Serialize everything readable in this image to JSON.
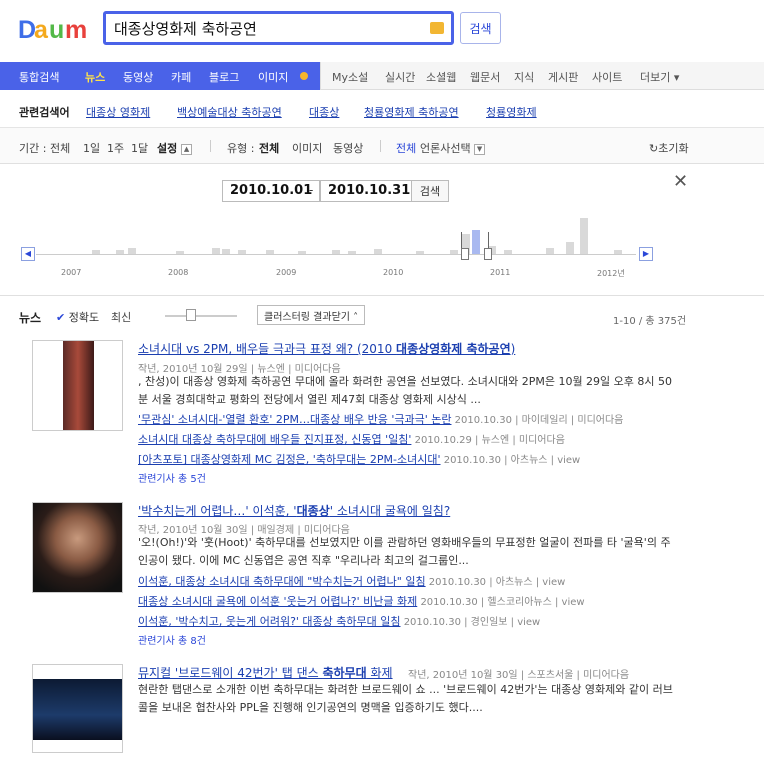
{
  "header": {
    "search_value": "대종상영화제 축하공연",
    "search_button": "검색",
    "colors": {
      "accent": "#4a62e8",
      "link": "#1b3fb0"
    }
  },
  "tabs": [
    "통합검색",
    "뉴스",
    "동영상",
    "카페",
    "블로그",
    "이미지",
    "My소설",
    "실시간",
    "소셜웹",
    "웹문서",
    "지식",
    "게시판",
    "사이트",
    "더보기"
  ],
  "related": {
    "label": "관련검색어",
    "items": [
      "대종상 영화제",
      "백상예술대상 축하공연",
      "대종상",
      "청룡영화제 축하공연",
      "청룡영화제"
    ]
  },
  "filters": {
    "period_label": "기간 :",
    "period_options": [
      "전체",
      "1일",
      "1주",
      "1달",
      "설정"
    ],
    "type_label": "유형 :",
    "type_options": [
      "전체",
      "이미지",
      "동영상"
    ],
    "press_all": "전체",
    "press_select": "언론사선택",
    "reset": "초기화"
  },
  "timeline": {
    "start": "2010.10.01",
    "end": "2010.10.31",
    "button": "검색",
    "years": [
      "2007",
      "2008",
      "2009",
      "2010",
      "2011",
      "2012년"
    ]
  },
  "results_header": {
    "title": "뉴스",
    "accuracy": "정확도",
    "recent": "최신",
    "cluster": "클러스터링 결과닫기",
    "count": "1-10 / 총 375건"
  },
  "results": [
    {
      "title_a": "소녀시대 vs 2PM, 배우들 극과극 표정 왜? (2010 ",
      "title_b": "대종상영화제 축하공연",
      "title_c": ")",
      "meta": "작년, 2010년 10월 29일 | 뉴스엔 | 미디어다음",
      "snippet": ", 찬성)이 대종상 영화제 축하공연 무대에 올라 화려한 공연을 선보였다. 소녀시대와 2PM은 10월 29일 오후 8시 50분 서울 경희대학교 평화의 전당에서 열린 제47회 대종상 영화제 시상식 ...",
      "subs": [
        {
          "text": "'무관심' 소녀시대-'열렬 환호' 2PM…대종상 배우 반응 '극과극' 논란",
          "meta": "2010.10.30 | 마이데일리 | 미디어다음"
        },
        {
          "text": "소녀시대 대종상 축하무대에 배우들 진지표정, 신동엽 '일침'",
          "meta": "2010.10.29 | 뉴스엔 | 미디어다음"
        },
        {
          "text": "[아츠포토] 대종상영화제 MC 김정은, '축하무대는 2PM-소녀시대'",
          "meta": "2010.10.30 | 아츠뉴스 | view"
        }
      ],
      "more": "관련기사 총 5건"
    },
    {
      "title_a": "'박수치는게 어렵나…' 이석훈, '",
      "title_b": "대종상",
      "title_c": "' 소녀시대 굴욕에 일침?",
      "meta": "작년, 2010년 10월 30일 | 매일경제 | 미디어다음",
      "snippet": "'오!(Oh!)'와 '훗(Hoot)' 축하무대를 선보였지만 이를 관람하던 영화배우들의 무표정한 얼굴이 전파를 타 '굴욕'의 주인공이 됐다. 이에 MC 신동엽은 공연 직후 \"우리나라 최고의 걸그룹인...",
      "subs": [
        {
          "text": "이석훈, 대종상 소녀시대 축하무대에 \"박수치는거 어렵나\" 일침",
          "meta": "2010.10.30 | 아츠뉴스 | view"
        },
        {
          "text": "대종상 소녀시대 굴욕에 이석훈 '웃는거 어렵나?' 비난글 화제",
          "meta": "2010.10.30 | 헬스코리아뉴스 | view"
        },
        {
          "text": "이석훈, '박수치고, 웃는게 어려워?' 대종상 축하무대 일침",
          "meta": "2010.10.30 | 경인일보 | view"
        }
      ],
      "more": "관련기사 총 8건"
    },
    {
      "title_a": "뮤지컬 '브로드웨이 42번가' 탭 댄스 ",
      "title_b": "축하무대",
      "title_c": " 화제",
      "meta": "작년, 2010년 10월 30일 | 스포츠서울 | 미디어다음",
      "snippet": "현란한 탭댄스로 소개한 이번 축하무대는 화려한 브로드웨이 쇼 ... '브로드웨이 42번가'는 대종상 영화제와 같이 러브콜을 보내온 협찬사와 PPL을 진행해 인기공연의 명맥을 입증하기도 했다...."
    }
  ]
}
